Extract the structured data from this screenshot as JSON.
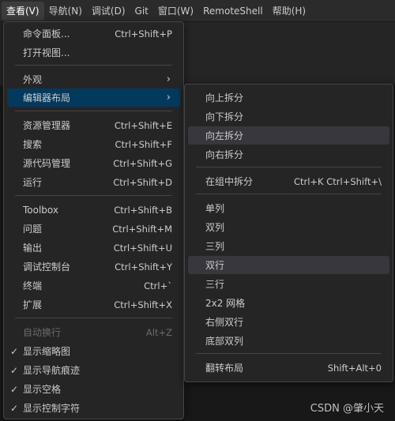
{
  "menubar": {
    "items": [
      "查看(V)",
      "导航(N)",
      "调试(D)",
      "Git",
      "窗口(W)",
      "RemoteShell",
      "帮助(H)"
    ]
  },
  "view_menu": {
    "command_palette": {
      "label": "命令面板...",
      "shortcut": "Ctrl+Shift+P"
    },
    "open_view": {
      "label": "打开视图..."
    },
    "appearance": {
      "label": "外观"
    },
    "editor_layout": {
      "label": "编辑器布局"
    },
    "explorer": {
      "label": "资源管理器",
      "shortcut": "Ctrl+Shift+E"
    },
    "search": {
      "label": "搜索",
      "shortcut": "Ctrl+Shift+F"
    },
    "source_control": {
      "label": "源代码管理",
      "shortcut": "Ctrl+Shift+G"
    },
    "run": {
      "label": "运行",
      "shortcut": "Ctrl+Shift+D"
    },
    "toolbox": {
      "label": "Toolbox",
      "shortcut": "Ctrl+Shift+B"
    },
    "problems": {
      "label": "问题",
      "shortcut": "Ctrl+Shift+M"
    },
    "output": {
      "label": "输出",
      "shortcut": "Ctrl+Shift+U"
    },
    "debug_console": {
      "label": "调试控制台",
      "shortcut": "Ctrl+Shift+Y"
    },
    "terminal": {
      "label": "终端",
      "shortcut": "Ctrl+`"
    },
    "extensions": {
      "label": "扩展",
      "shortcut": "Ctrl+Shift+X"
    },
    "word_wrap": {
      "label": "自动换行",
      "shortcut": "Alt+Z"
    },
    "minimap": {
      "label": "显示缩略图"
    },
    "breadcrumbs": {
      "label": "显示导航痕迹"
    },
    "whitespace": {
      "label": "显示空格"
    },
    "control_chars": {
      "label": "显示控制字符"
    }
  },
  "layout_submenu": {
    "split_up": {
      "label": "向上拆分"
    },
    "split_down": {
      "label": "向下拆分"
    },
    "split_left": {
      "label": "向左拆分"
    },
    "split_right": {
      "label": "向右拆分"
    },
    "split_in_group": {
      "label": "在组中拆分",
      "shortcut": "Ctrl+K Ctrl+Shift+\\"
    },
    "single": {
      "label": "单列"
    },
    "two_columns": {
      "label": "双列"
    },
    "three_columns": {
      "label": "三列"
    },
    "two_rows": {
      "label": "双行"
    },
    "three_rows": {
      "label": "三行"
    },
    "grid_2x2": {
      "label": "2x2 网格"
    },
    "two_rows_right": {
      "label": "右侧双行"
    },
    "two_columns_bottom": {
      "label": "底部双列"
    },
    "flip_layout": {
      "label": "翻转布局",
      "shortcut": "Shift+Alt+0"
    }
  },
  "icons": {
    "check": "✓",
    "chevron": "›"
  },
  "watermark": "CSDN @肇小天"
}
